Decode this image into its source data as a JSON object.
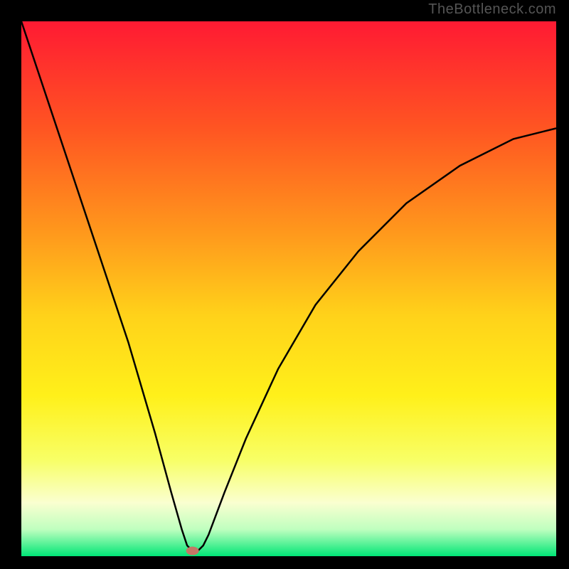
{
  "watermark": "TheBottleneck.com",
  "chart_data": {
    "type": "line",
    "title": "",
    "xlabel": "",
    "ylabel": "",
    "xlim": [
      0,
      100
    ],
    "ylim": [
      0,
      100
    ],
    "grid": false,
    "legend": false,
    "background_gradient": {
      "stops": [
        {
          "pos": 0.0,
          "color": "#ff1a33"
        },
        {
          "pos": 0.2,
          "color": "#ff5522"
        },
        {
          "pos": 0.4,
          "color": "#ff9a1c"
        },
        {
          "pos": 0.55,
          "color": "#ffd21a"
        },
        {
          "pos": 0.7,
          "color": "#fff01a"
        },
        {
          "pos": 0.82,
          "color": "#f8ff66"
        },
        {
          "pos": 0.9,
          "color": "#faffd0"
        },
        {
          "pos": 0.95,
          "color": "#bfffbf"
        },
        {
          "pos": 1.0,
          "color": "#00e676"
        }
      ]
    },
    "series": [
      {
        "name": "curve",
        "color": "#000000",
        "x": [
          0,
          5,
          10,
          15,
          20,
          25,
          28,
          30,
          31,
          32,
          33,
          34,
          35,
          38,
          42,
          48,
          55,
          63,
          72,
          82,
          92,
          100
        ],
        "values": [
          100,
          85,
          70,
          55,
          40,
          23,
          12,
          5,
          2,
          1,
          1,
          2,
          4,
          12,
          22,
          35,
          47,
          57,
          66,
          73,
          78,
          80
        ]
      }
    ],
    "marker": {
      "name": "optimal-point",
      "x": 32,
      "y": 1,
      "color": "#c47766"
    }
  }
}
